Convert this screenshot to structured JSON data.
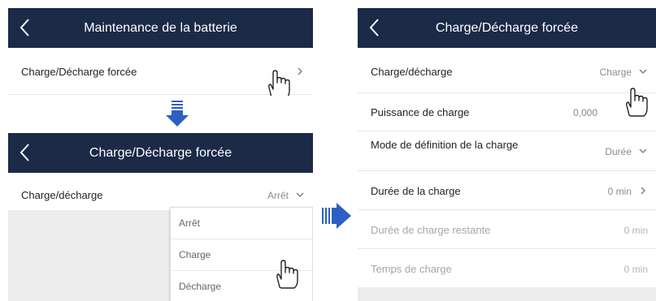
{
  "panel_a": {
    "title": "Maintenance de la batterie",
    "row_label": "Charge/Décharge forcée"
  },
  "panel_b": {
    "title": "Charge/Décharge forcée",
    "row_label": "Charge/décharge",
    "row_value": "Arrêt",
    "options": [
      "Arrêt",
      "Charge",
      "Décharge"
    ]
  },
  "panel_c": {
    "title": "Charge/Décharge forcée",
    "rows": [
      {
        "label": "Charge/décharge",
        "value": "Charge"
      },
      {
        "label": "Puissance de charge",
        "value": "0,000"
      },
      {
        "label": "Mode de définition de la charge",
        "value": "Durée"
      },
      {
        "label": "Durée de la charge",
        "value": "0 min"
      },
      {
        "label": "Durée de charge restante",
        "value": "0 min"
      },
      {
        "label": "Temps de charge",
        "value": "0 min"
      }
    ]
  },
  "colors": {
    "header": "#1a2a47",
    "flow_arrow": "#2d5ec4",
    "overlay": "#ececec"
  },
  "icons": [
    "back-arrow-icon",
    "chevron-right-icon",
    "chevron-down-icon",
    "tap-hand-icon",
    "flow-arrow-down-icon",
    "flow-arrow-right-icon"
  ]
}
